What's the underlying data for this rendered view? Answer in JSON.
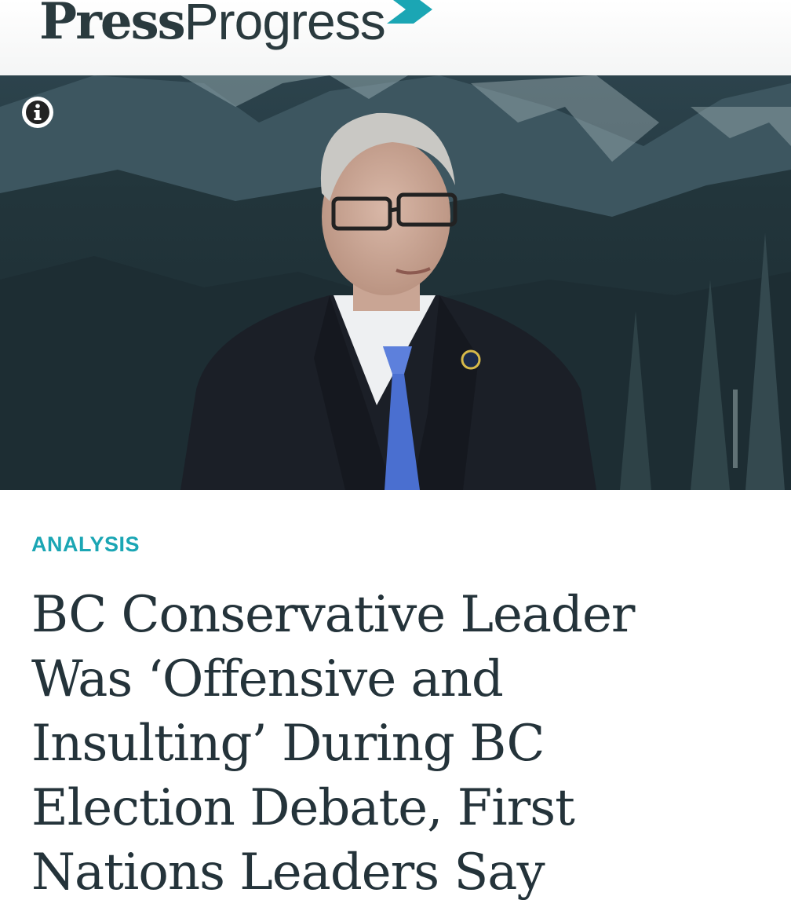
{
  "header": {
    "logo_press": "Press",
    "logo_progress": "Progress",
    "logo_icon": "chevron-right-icon",
    "accent_color": "#1ba6b4",
    "text_color": "#2a3a3e"
  },
  "hero": {
    "info_icon": "info-icon"
  },
  "article": {
    "category": "ANALYSIS",
    "category_color": "#1ba6b4",
    "title_lines": [
      "BC Conservative Leader",
      "Was ‘Offensive and",
      "Insulting’ During BC",
      "Election Debate, First",
      "Nations Leaders Say"
    ],
    "title_color": "#24333a"
  }
}
